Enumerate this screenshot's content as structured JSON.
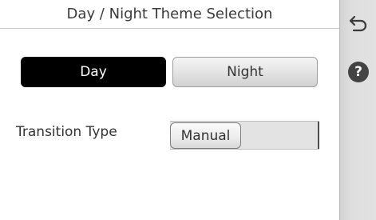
{
  "header": {
    "title": "Day / Night Theme Selection"
  },
  "theme_selector": {
    "options": [
      {
        "label": "Day",
        "selected": true
      },
      {
        "label": "Night",
        "selected": false
      }
    ]
  },
  "transition": {
    "label": "Transition Type",
    "value": "Manual"
  },
  "sidebar": {
    "back_icon": "back-arrow-icon",
    "help_icon": "help-icon",
    "help_glyph": "?"
  },
  "colors": {
    "selected_bg": "#000000",
    "selected_text": "#ffffff",
    "unselected_bg": "#dcdcdc",
    "sidebar_bg": "#dddddd",
    "help_icon_bg": "#434343"
  }
}
